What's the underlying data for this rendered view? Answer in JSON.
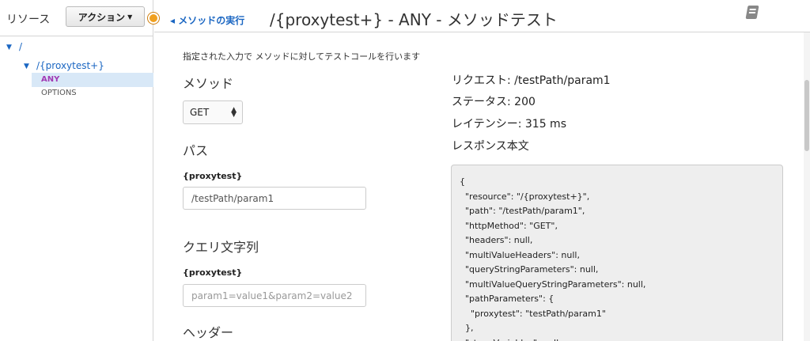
{
  "sidebar": {
    "title": "リソース",
    "action_label": "アクション",
    "tree": {
      "root": "/",
      "child": "/{proxytest+}",
      "methods": [
        "ANY",
        "OPTIONS"
      ]
    }
  },
  "header": {
    "back_link": "メソッドの実行",
    "title": "/{proxytest+} - ANY - メソッドテスト"
  },
  "form": {
    "description": "指定された入力で メソッドに対してテストコールを行います",
    "method_label": "メソッド",
    "method_value": "GET",
    "path_label": "パス",
    "path_param_name": "{proxytest}",
    "path_param_value": "/testPath/param1",
    "query_label": "クエリ文字列",
    "query_param_name": "{proxytest}",
    "query_placeholder": "param1=value1&param2=value2",
    "headers_label": "ヘッダー"
  },
  "result": {
    "request": "リクエスト: /testPath/param1",
    "status": "ステータス: 200",
    "latency": "レイテンシー: 315 ms",
    "body_label": "レスポンス本文",
    "body": "{\n  \"resource\": \"/{proxytest+}\",\n  \"path\": \"/testPath/param1\",\n  \"httpMethod\": \"GET\",\n  \"headers\": null,\n  \"multiValueHeaders\": null,\n  \"queryStringParameters\": null,\n  \"multiValueQueryStringParameters\": null,\n  \"pathParameters\": {\n    \"proxytest\": \"testPath/param1\"\n  },\n  \"stageVariables\": null,"
  },
  "colors": {
    "link": "#1a66c2",
    "any_method": "#a23ab5",
    "selected_bg": "#d8e8f7",
    "dot": "#f0a020"
  }
}
